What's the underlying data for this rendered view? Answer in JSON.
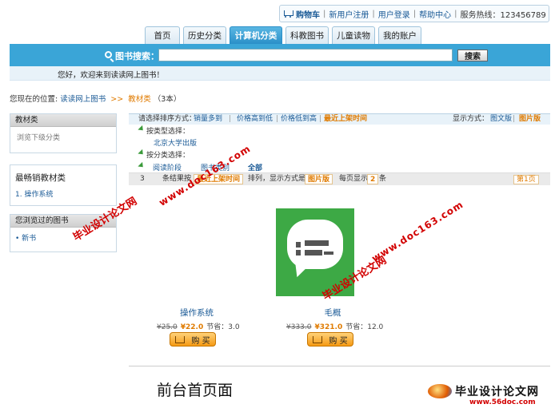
{
  "topbar": {
    "cart": "购物车",
    "links": [
      "新用户注册",
      "用户登录",
      "帮助中心",
      "服务热线：123456789"
    ]
  },
  "nav": {
    "tabs": [
      "首页",
      "历史分类",
      "计算机分类",
      "科教图书",
      "儿童读物",
      "我的账户"
    ],
    "active_index": 2
  },
  "search": {
    "label": "图书搜索：",
    "value": "",
    "button": "搜索"
  },
  "welcome": "您好，欢迎来到读读网上图书！",
  "breadcrumb": {
    "prefix": "您现在的位置:",
    "home": "读读网上图书",
    "arrow": ">>",
    "current": "教材类",
    "count": "（3本）"
  },
  "sidebar": {
    "category_head": "教材类",
    "category_body": "浏览下级分类",
    "bestseller_title": "最畅销教材类",
    "bestseller_item": "1. 操作系统",
    "recent_head": "您浏览过的图书",
    "recent_item": "• 新书"
  },
  "filter": {
    "sort_label": "请选择排序方式：",
    "sort_options": [
      "销量多到",
      "价格高到低",
      "价格低到高",
      "最近上架时间"
    ],
    "view_label": "显示方式：",
    "view_options": [
      "图文版",
      "图片版"
    ],
    "by_type": "按类型选择：",
    "publisher": "北京大学出版",
    "by_category": "按分类选择：",
    "levels": [
      "阅读阶段",
      "图书类别",
      "全部"
    ],
    "result_texts": [
      "3",
      "条结果按",
      "排列，显示方式是",
      "每页显示",
      "条"
    ],
    "result_sort": "最近上架时间",
    "result_view": "图片版",
    "per_page": "2",
    "page": "第1页"
  },
  "products": [
    {
      "name": "操作系统",
      "old_price": "¥25.0",
      "new_price": "¥22.0",
      "save": "节省：3.0",
      "buy": "购 买"
    },
    {
      "name": "毛概",
      "old_price": "¥333.0",
      "new_price": "¥321.0",
      "save": "节省：12.0",
      "buy": "购 买"
    }
  ],
  "caption": "前台首页面",
  "watermarks": {
    "site": "毕业设计论文网",
    "url": "www.doc163.com",
    "footer_url": "www.56doc.com"
  }
}
